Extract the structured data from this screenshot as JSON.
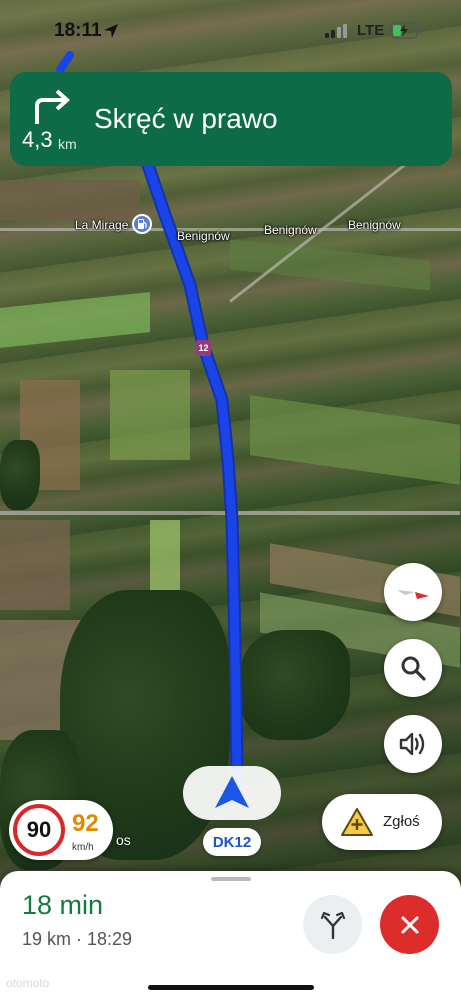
{
  "status_bar": {
    "time": "18:11",
    "network": "LTE"
  },
  "banner": {
    "instruction": "Skręć w prawo",
    "distance_value": "4,3",
    "distance_unit": "km",
    "maneuver_icon": "turn-right-icon",
    "color": "#0e6b47"
  },
  "map": {
    "poi_label": "La Mirage",
    "place_labels": [
      "Benignów",
      "Benignów",
      "Benignów"
    ],
    "route_shield": "12",
    "route_color": "#1a44e8"
  },
  "location": {
    "road_name": "DK12"
  },
  "speed": {
    "limit": "90",
    "current": "92",
    "unit": "km/h",
    "limit_color": "#d62a2a",
    "current_color": "#e08a00"
  },
  "map_partial_label": "os",
  "report": {
    "label": "Zgłoś"
  },
  "trip": {
    "duration": "18 min",
    "details": "19 km · 18:29"
  },
  "watermark": "otomoto"
}
